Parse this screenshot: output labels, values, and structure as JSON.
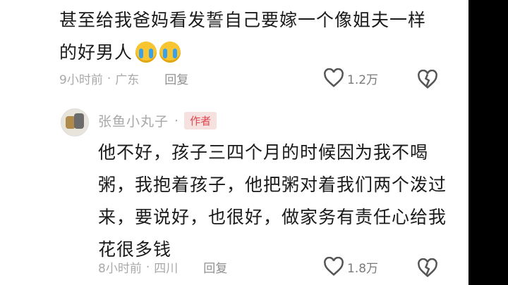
{
  "comments": [
    {
      "text": "甚至给我爸妈看发誓自己要嫁一个像姐夫一样的好男人",
      "emojis": [
        "crying-emoji",
        "crying-emoji"
      ],
      "time": "9小时前",
      "separator": "·",
      "location": "广东",
      "reply_label": "回复",
      "likes": "1.2万"
    },
    {
      "author": "张鱼小丸子",
      "author_separator": "·",
      "author_badge": "作者",
      "text": "他不好，孩子三四个月的时候因为我不喝粥，我抱着孩子，他把粥对着我们两个泼过来，要说好，也很好，做家务有责任心给我花很多钱",
      "time": "8小时前",
      "separator": "·",
      "location": "四川",
      "reply_label": "回复",
      "likes": "1.8万"
    }
  ],
  "icons": {
    "like": "heart-outline-icon",
    "dislike": "broken-heart-icon"
  }
}
